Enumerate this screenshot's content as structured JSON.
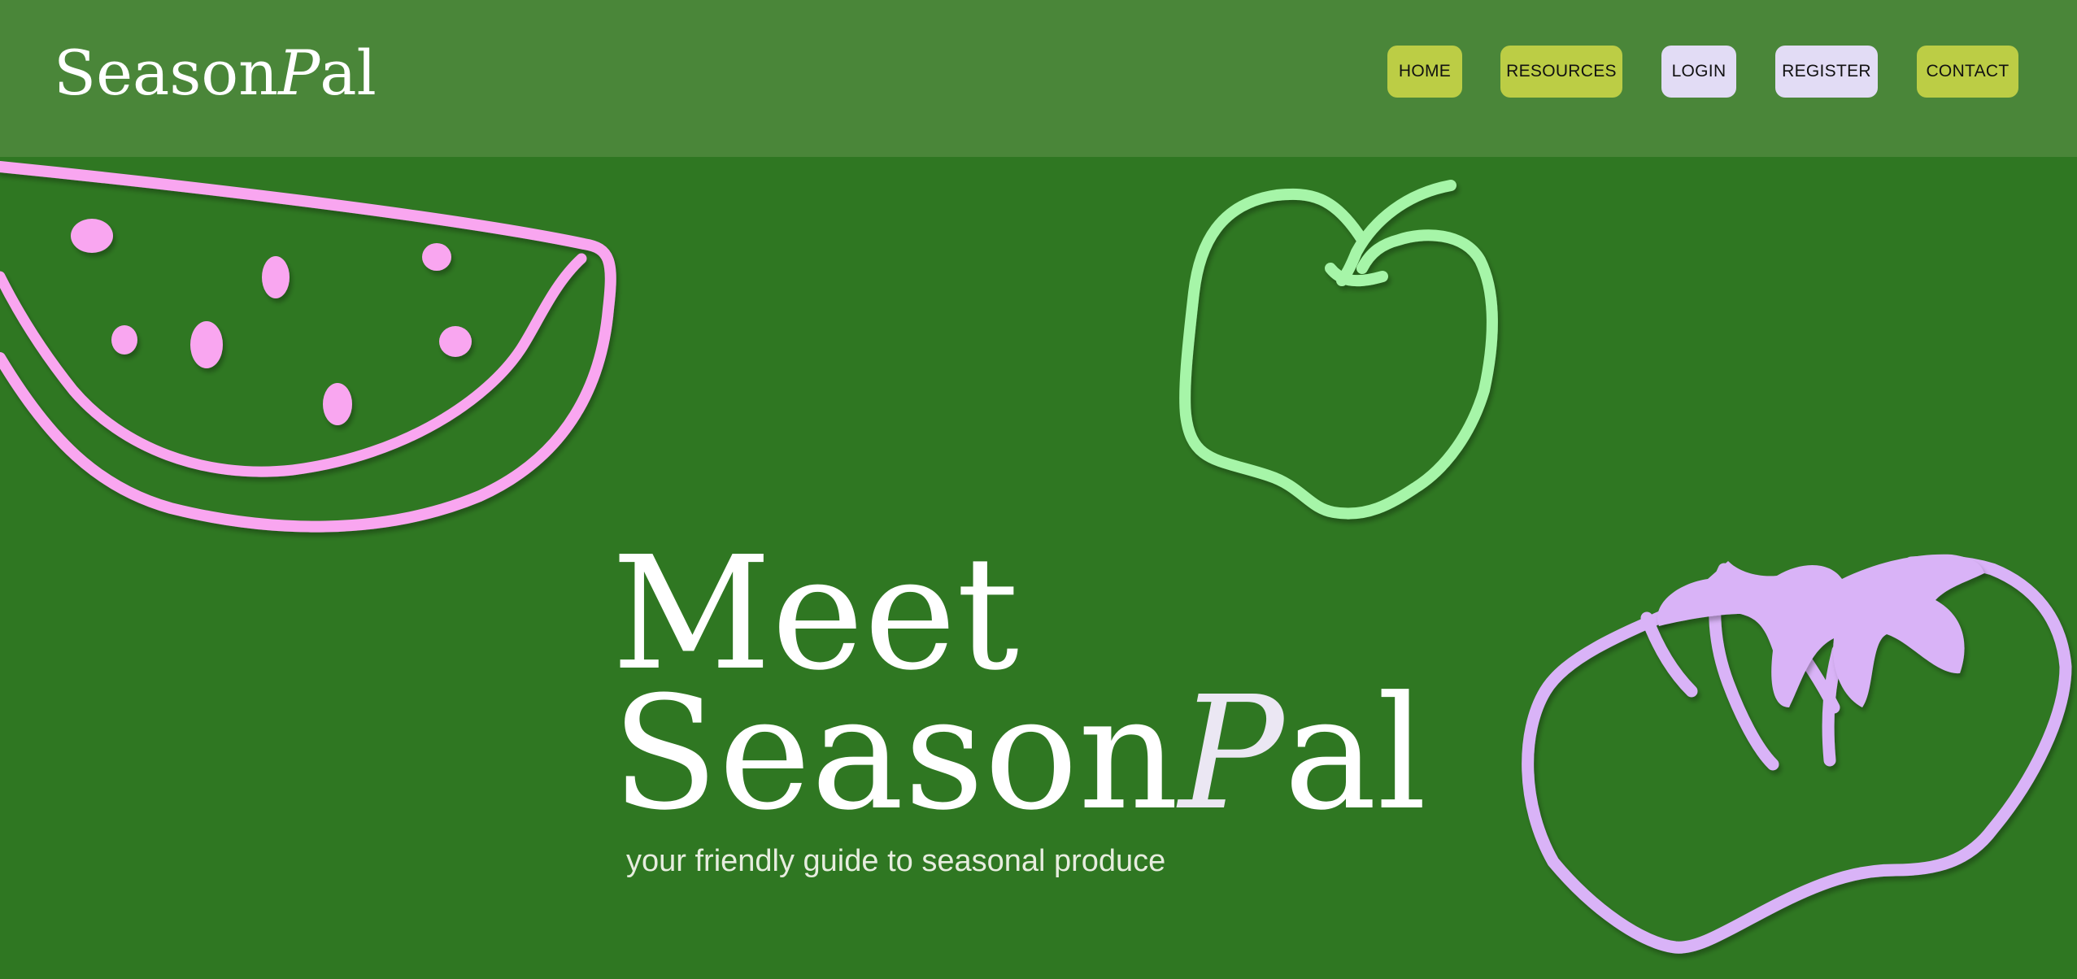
{
  "brand": {
    "name_part1": "Season",
    "name_part2": "P",
    "name_part3": "al"
  },
  "nav": {
    "home": "HOME",
    "resources": "RESOURCES",
    "login": "LOGIN",
    "register": "REGISTER",
    "contact": "CONTACT"
  },
  "hero": {
    "line1": "Meet",
    "line2_part1": "Season",
    "line2_part2": "P",
    "line2_part3": "al",
    "tagline": "your friendly guide to seasonal produce"
  },
  "colors": {
    "page_background": "#2f7722",
    "header_background": "#4a8639",
    "nav_primary": "#bccd45",
    "nav_secondary": "#e2dcf5",
    "watermelon": "#f9a6f0",
    "apple": "#a6f5a8",
    "tomato": "#d9b3f7"
  },
  "illustrations": [
    "watermelon-icon",
    "apple-icon",
    "tomato-icon"
  ]
}
